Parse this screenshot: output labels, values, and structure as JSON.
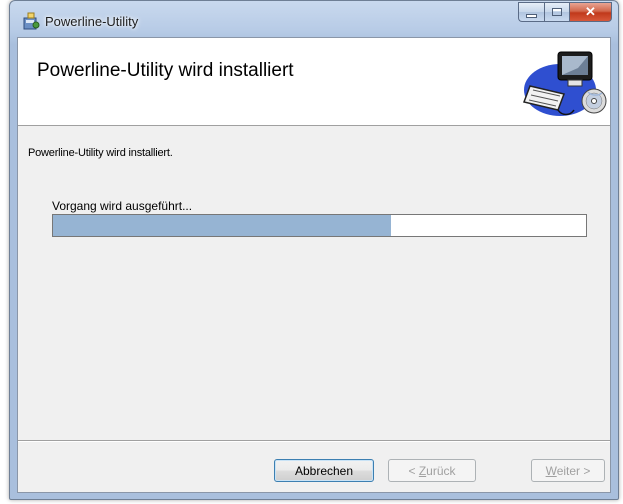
{
  "window": {
    "title": "Powerline-Utility",
    "icon": "installer-package-icon",
    "caption_buttons": {
      "minimize": "minimize-icon",
      "maximize": "maximize-icon",
      "close": "✕"
    }
  },
  "banner": {
    "title": "Powerline-Utility wird installiert",
    "image": "computer-setup-icon"
  },
  "status": {
    "text": "Powerline-Utility wird installiert."
  },
  "progress": {
    "label": "Vorgang wird ausgeführt...",
    "value": 0.634
  },
  "buttons": {
    "cancel": "Abbrechen",
    "back_prefix": "< ",
    "back_accel": "Z",
    "back_rest": "urück",
    "next_accel": "W",
    "next_rest": "eiter >"
  },
  "colors": {
    "progress_fill": "#96b4d3",
    "dialog_bg": "#f0f0f0"
  }
}
